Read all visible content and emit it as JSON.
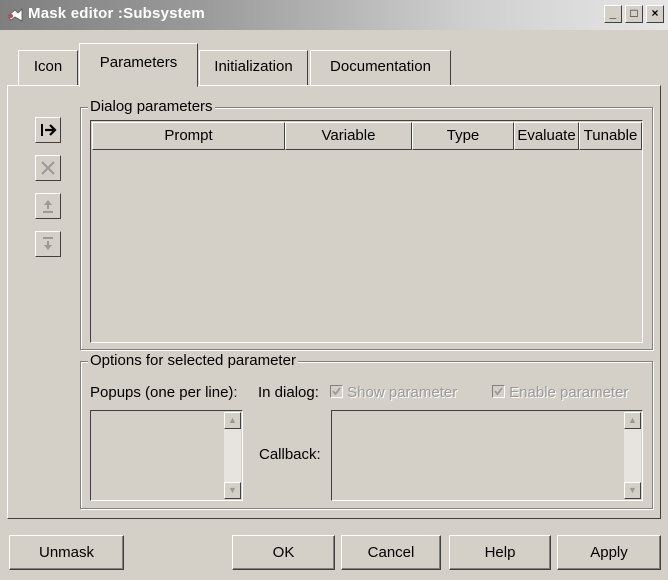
{
  "window": {
    "title": "Mask editor :Subsystem",
    "controls": {
      "minimize": "_",
      "maximize": "□",
      "close": "×"
    }
  },
  "tabs": [
    {
      "label": "Icon"
    },
    {
      "label": "Parameters",
      "selected": true
    },
    {
      "label": "Initialization"
    },
    {
      "label": "Documentation"
    }
  ],
  "dialog_parameters": {
    "title": "Dialog parameters",
    "columns": [
      "Prompt",
      "Variable",
      "Type",
      "Evaluate",
      "Tunable"
    ],
    "rows": [],
    "side_buttons": [
      {
        "icon": "add-parameter-icon",
        "enabled": true
      },
      {
        "icon": "delete-icon",
        "enabled": false
      },
      {
        "icon": "move-up-icon",
        "enabled": false
      },
      {
        "icon": "move-down-icon",
        "enabled": false
      }
    ]
  },
  "options": {
    "title": "Options for selected parameter",
    "popups_label": "Popups (one per line):",
    "in_dialog_label": "In dialog:",
    "show_parameter_label": "Show parameter",
    "enable_parameter_label": "Enable parameter",
    "callback_label": "Callback:",
    "popups_value": "",
    "callback_value": ""
  },
  "buttons": {
    "unmask": "Unmask",
    "ok": "OK",
    "cancel": "Cancel",
    "help": "Help",
    "apply": "Apply"
  }
}
